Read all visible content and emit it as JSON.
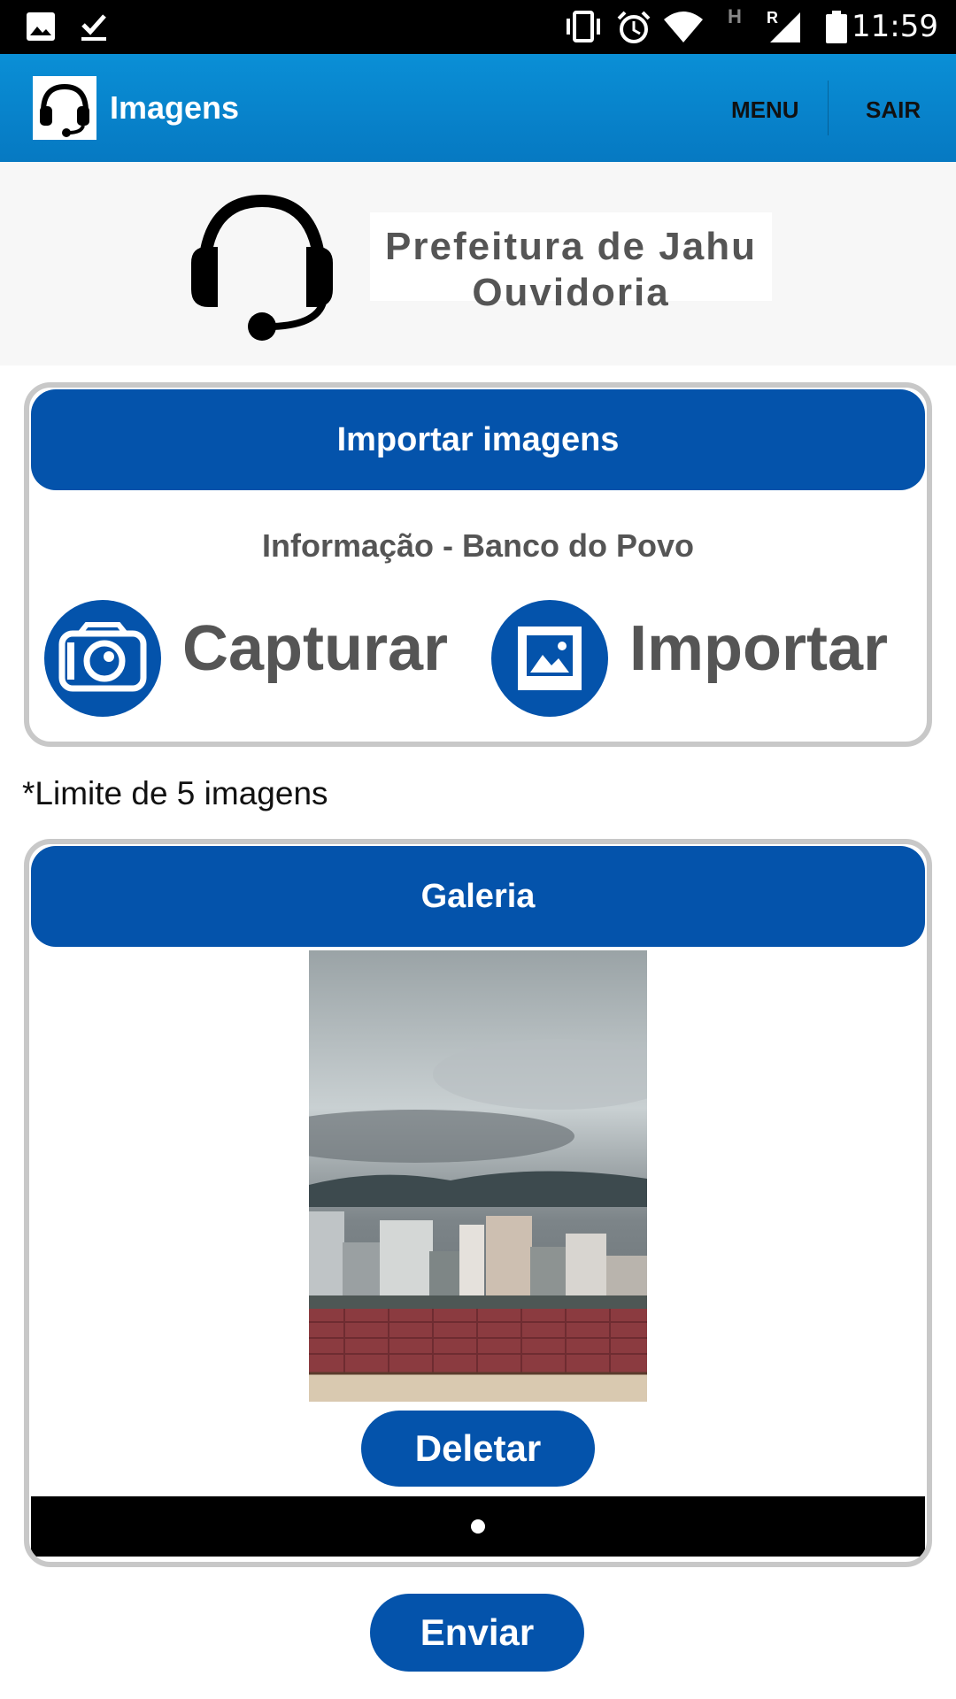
{
  "status_bar": {
    "time": "11:59",
    "icons": [
      "image-icon",
      "download-done-icon",
      "vibrate-icon",
      "alarm-icon",
      "wifi-icon",
      "signal-h-icon",
      "signal-r-icon",
      "battery-icon"
    ],
    "network_h": "H",
    "network_r": "R"
  },
  "app_bar": {
    "title": "Imagens",
    "menu_label": "MENU",
    "logout_label": "SAIR",
    "logo_icon": "headset-icon"
  },
  "banner": {
    "line1": "Prefeitura de Jahu",
    "line2": "Ouvidoria",
    "logo_icon": "headset-icon"
  },
  "import_panel": {
    "header": "Importar imagens",
    "info": "Informação - Banco do Povo",
    "capture_label": "Capturar",
    "capture_icon": "camera-icon",
    "import_label": "Importar",
    "import_icon": "image-icon"
  },
  "limit_text": "*Limite de 5 imagens",
  "gallery": {
    "header": "Galeria",
    "delete_label": "Deletar",
    "page_count": 1,
    "current_page": 1
  },
  "send_label": "Enviar",
  "colors": {
    "accent": "#0453ab",
    "app_bar": "#0a8fd6",
    "status_bar": "#000000",
    "panel_border": "#c8c8c8",
    "text_gray": "#555555"
  }
}
